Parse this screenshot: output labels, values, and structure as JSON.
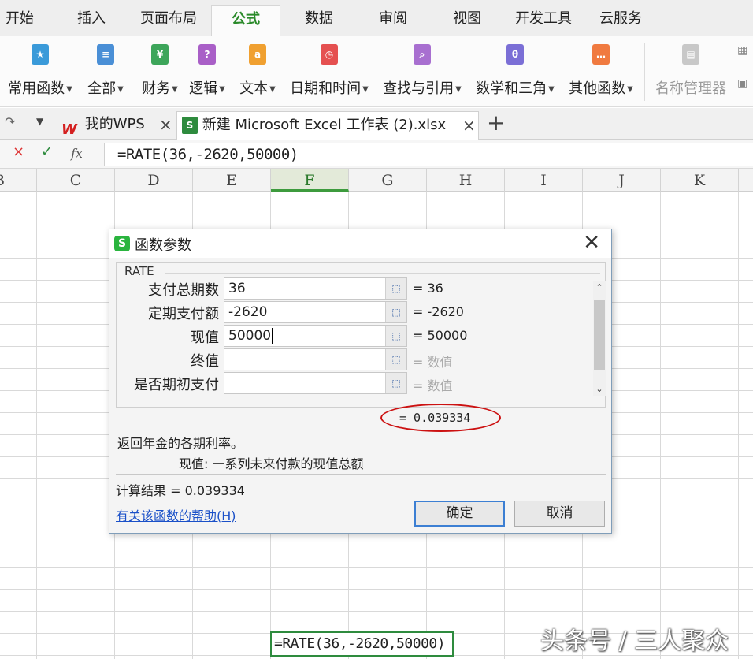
{
  "ribbon_tabs": [
    "开始",
    "插入",
    "页面布局",
    "公式",
    "数据",
    "审阅",
    "视图",
    "开发工具",
    "云服务"
  ],
  "active_tab": "公式",
  "ribbon_buttons": [
    {
      "label": "常用函数",
      "icon": "star-icon"
    },
    {
      "label": "全部",
      "icon": "list-icon"
    },
    {
      "label": "财务",
      "icon": "finance-icon"
    },
    {
      "label": "逻辑",
      "icon": "question-icon"
    },
    {
      "label": "文本",
      "icon": "text-icon"
    },
    {
      "label": "日期和时间",
      "icon": "clock-icon"
    },
    {
      "label": "查找与引用",
      "icon": "magnifier-icon"
    },
    {
      "label": "数学和三角",
      "icon": "theta-icon"
    },
    {
      "label": "其他函数",
      "icon": "ellipsis-icon"
    },
    {
      "label": "名称管理器",
      "icon": "name-manager-icon"
    }
  ],
  "doc_tabs": {
    "home": "我的WPS",
    "file": "新建 Microsoft Excel 工作表 (2).xlsx"
  },
  "formula_bar": {
    "cancel": "×",
    "confirm": "✓",
    "fx": "fx",
    "formula": "=RATE(36,-2620,50000)"
  },
  "columns": [
    "B",
    "C",
    "D",
    "E",
    "F",
    "G",
    "H",
    "I",
    "J",
    "K"
  ],
  "selected_column": "F",
  "active_cell_text": "=RATE(36,-2620,50000)",
  "dialog": {
    "title": "函数参数",
    "function_name": "RATE",
    "args": [
      {
        "label": "支付总期数",
        "value": "36",
        "result": "= 36",
        "muted": false
      },
      {
        "label": "定期支付额",
        "value": "-2620",
        "result": "= -2620",
        "muted": false
      },
      {
        "label": "现值",
        "value": "50000",
        "result": "= 50000",
        "muted": false
      },
      {
        "label": "终值",
        "value": "",
        "result": "= 数值",
        "muted": true
      },
      {
        "label": "是否期初支付",
        "value": "",
        "result": "= 数值",
        "muted": true
      }
    ],
    "total_result": "= 0.039334",
    "description": "返回年金的各期利率。",
    "arg_description": "现值: 一系列未来付款的现值总额",
    "calc_result": "计算结果 = 0.039334",
    "help_link": "有关该函数的帮助(H)",
    "ok": "确定",
    "cancel": "取消"
  },
  "watermark": "头条号 / 三人聚众",
  "colors": {
    "accent_green": "#2e8b3e",
    "annotation_red": "#cc1111",
    "link_blue": "#1a50c8"
  }
}
